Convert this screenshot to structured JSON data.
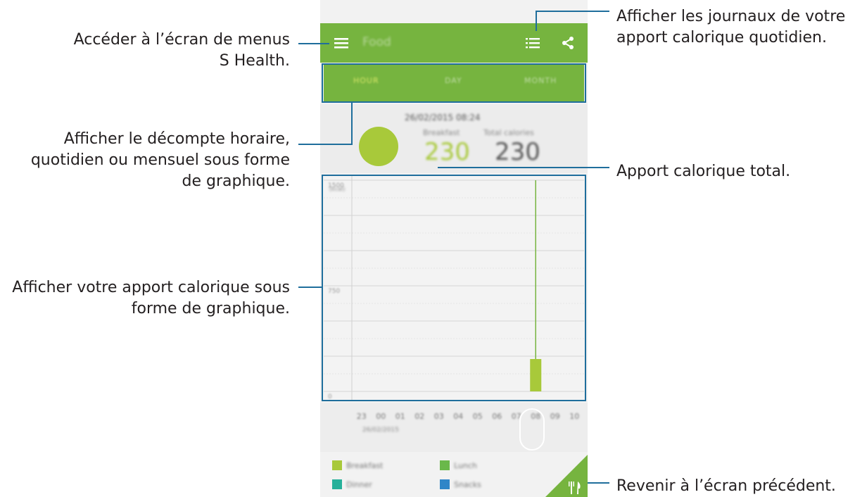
{
  "callouts": {
    "menu": [
      "Accéder à l’écran de menus",
      "S Health."
    ],
    "graph_period": [
      "Afficher le décompte horaire,",
      "quotidien ou mensuel sous forme",
      "de graphique."
    ],
    "intake_graph": [
      "Afficher votre apport calorique sous",
      "forme de graphique."
    ],
    "logs": [
      "Afficher les journaux de votre",
      "apport calorique quotidien."
    ],
    "total": [
      "Apport calorique total."
    ],
    "back": [
      "Revenir à l’écran précédent."
    ]
  },
  "screen": {
    "title": "Food",
    "tabs": [
      "HOUR",
      "DAY",
      "MONTH"
    ],
    "datetime": "26/02/2015 08:24",
    "meal_label": "Breakfast",
    "meal_value": "230",
    "total_label": "Total calories",
    "total_value": "230",
    "y_unit": "(kcal)",
    "axis_date": "26/02/2015",
    "legend": [
      {
        "label": "Breakfast",
        "color": "#a8c93a"
      },
      {
        "label": "Lunch",
        "color": "#6ab84a"
      },
      {
        "label": "Dinner",
        "color": "#26b09a"
      },
      {
        "label": "Snacks",
        "color": "#2f86c8"
      }
    ]
  },
  "chart_data": {
    "type": "bar",
    "categories": [
      "23",
      "00",
      "01",
      "02",
      "03",
      "04",
      "05",
      "06",
      "07",
      "08",
      "09",
      "10"
    ],
    "values": [
      0,
      0,
      0,
      0,
      0,
      0,
      0,
      0,
      0,
      230,
      0,
      0
    ],
    "selected": "08",
    "ylim": [
      0,
      1500
    ],
    "yticks": [
      "1500",
      "750",
      "0"
    ],
    "colors": {
      "accent": "#76b43f",
      "bar": "#a8c93a",
      "callout_line": "#1f6e9c"
    }
  }
}
